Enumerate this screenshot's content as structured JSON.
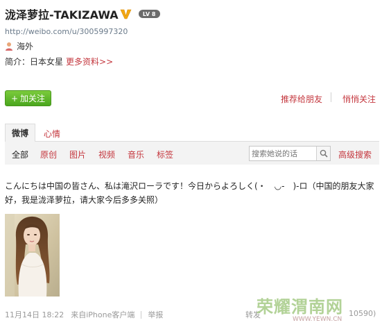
{
  "profile": {
    "name": "泷泽萝拉-TAKIZAWA",
    "level_badge": "LV 8",
    "url": "http://weibo.com/u/3005997320",
    "location": "海外",
    "intro_label": "简介：",
    "intro_text": "日本女星",
    "more_info": "更多资料>>"
  },
  "actions": {
    "follow_plus": "+",
    "follow": "加关注",
    "recommend": "推荐给朋友",
    "secret_follow": "悄悄关注"
  },
  "tabs": {
    "weibo": "微博",
    "mood": "心情"
  },
  "filters": [
    "全部",
    "原创",
    "图片",
    "视频",
    "音乐",
    "标签"
  ],
  "search": {
    "placeholder": "搜索她说的话",
    "advanced": "高级搜索"
  },
  "post": {
    "text": "こんにちは中国の皆さん、私は滝沢ローラです！今日からよろしく(・　◡-　)-ロ（中国的朋友大家好，我是泷泽萝拉，请大家今后多多关照）",
    "date": "11月14日 18:22",
    "source": "来自iPhone客户端",
    "report": "举报",
    "repost": "转发",
    "count": "10590)"
  },
  "watermark": {
    "title": "荣耀渭南网",
    "url": "WWW.YEWN.CN"
  },
  "colors": {
    "link": "#c4373e",
    "follow_green": "#5cb82a",
    "verified_gold": "#f2a814"
  },
  "icons": {
    "verified": "verified-v-icon",
    "person": "person-icon",
    "search": "search-icon"
  }
}
